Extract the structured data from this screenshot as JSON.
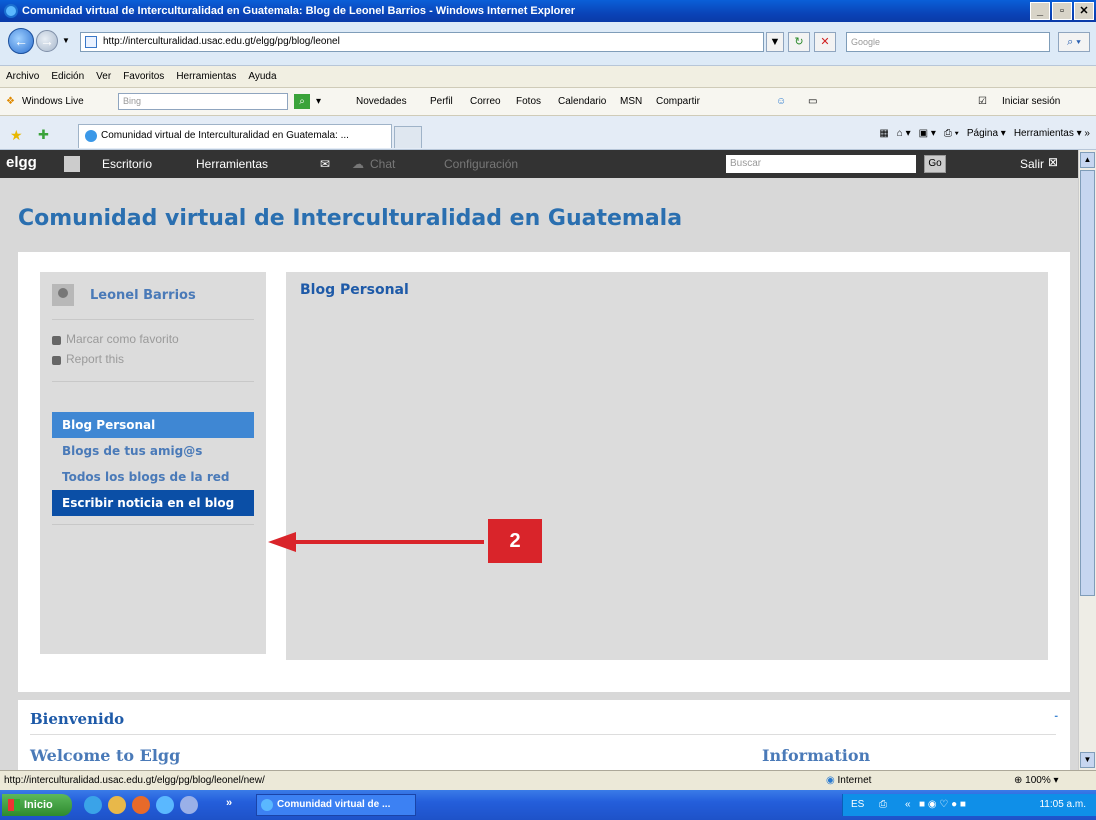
{
  "window": {
    "title": "Comunidad virtual de Interculturalidad en Guatemala: Blog de Leonel Barrios - Windows Internet Explorer"
  },
  "address": {
    "url": "http://interculturalidad.usac.edu.gt/elgg/pg/blog/leonel",
    "search_placeholder": "Google"
  },
  "menu": [
    "Archivo",
    "Edición",
    "Ver",
    "Favoritos",
    "Herramientas",
    "Ayuda"
  ],
  "live_toolbar": {
    "brand": "Windows Live",
    "search_placeholder": "Bing",
    "links": [
      "Novedades",
      "Perfil",
      "Correo",
      "Fotos",
      "Calendario",
      "MSN",
      "Compartir"
    ],
    "signin": "Iniciar sesión"
  },
  "tabs": {
    "active": "Comunidad virtual de Interculturalidad en Guatemala: ...",
    "commands": [
      "Página",
      "Herramientas"
    ]
  },
  "elgg_bar": {
    "logo": "elgg",
    "links": [
      "Escritorio",
      "Herramientas",
      "Chat",
      "Configuración"
    ],
    "search_placeholder": "Buscar",
    "go": "Go",
    "logout": "Salir"
  },
  "site": {
    "title": "Comunidad virtual de Interculturalidad en Guatemala"
  },
  "owner": {
    "name": "Leonel Barrios",
    "actions": [
      "Marcar como favorito",
      "Report this"
    ]
  },
  "sidebar_menu": [
    {
      "label": "Blog Personal",
      "state": "selected"
    },
    {
      "label": "Blogs de tus amig@s",
      "state": "normal"
    },
    {
      "label": "Todos los blogs de la red",
      "state": "normal"
    },
    {
      "label": "Escribir noticia en el blog",
      "state": "highlighted"
    }
  ],
  "content": {
    "heading": "Blog Personal"
  },
  "annotation": {
    "badge": "2",
    "color": "#d9242a"
  },
  "welcome": {
    "title": "Bienvenido",
    "left": "Welcome to Elgg",
    "right": "Information"
  },
  "status": {
    "url": "http://interculturalidad.usac.edu.gt/elgg/pg/blog/leonel/new/",
    "zone": "Internet",
    "zoom": "100%"
  },
  "taskbar": {
    "start": "Inicio",
    "task": "Comunidad virtual de ...",
    "clock": "11:05 a.m."
  }
}
